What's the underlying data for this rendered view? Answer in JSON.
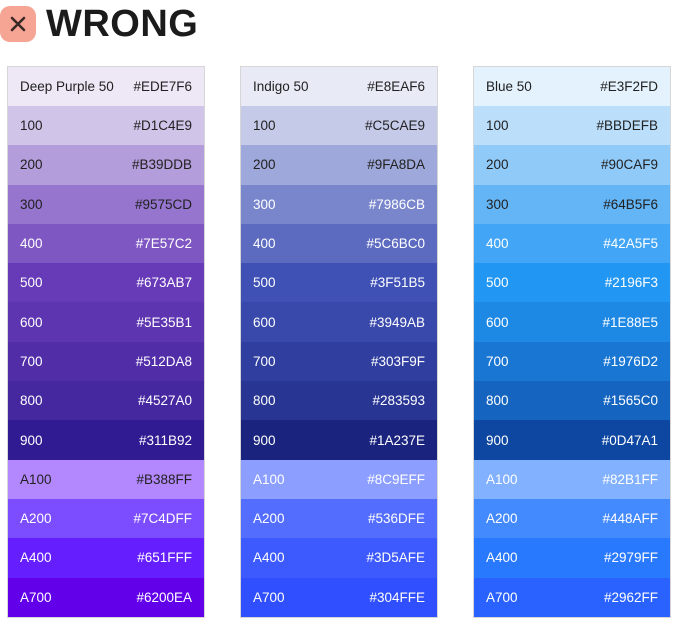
{
  "header": {
    "icon": "close-icon",
    "badge_color": "#F6A594",
    "title": "WRONG"
  },
  "palettes": [
    {
      "swatches": [
        {
          "name": "Deep Purple 50",
          "hex": "#EDE7F6",
          "text": "#212121"
        },
        {
          "name": "100",
          "hex": "#D1C4E9",
          "text": "#212121"
        },
        {
          "name": "200",
          "hex": "#B39DDB",
          "text": "#212121"
        },
        {
          "name": "300",
          "hex": "#9575CD",
          "text": "#212121"
        },
        {
          "name": "400",
          "hex": "#7E57C2",
          "text": "#ffffff"
        },
        {
          "name": "500",
          "hex": "#673AB7",
          "text": "#ffffff"
        },
        {
          "name": "600",
          "hex": "#5E35B1",
          "text": "#ffffff"
        },
        {
          "name": "700",
          "hex": "#512DA8",
          "text": "#ffffff"
        },
        {
          "name": "800",
          "hex": "#4527A0",
          "text": "#ffffff"
        },
        {
          "name": "900",
          "hex": "#311B92",
          "text": "#ffffff"
        },
        {
          "name": "A100",
          "hex": "#B388FF",
          "text": "#212121"
        },
        {
          "name": "A200",
          "hex": "#7C4DFF",
          "text": "#ffffff"
        },
        {
          "name": "A400",
          "hex": "#651FFF",
          "text": "#ffffff"
        },
        {
          "name": "A700",
          "hex": "#6200EA",
          "text": "#ffffff"
        }
      ]
    },
    {
      "swatches": [
        {
          "name": "Indigo 50",
          "hex": "#E8EAF6",
          "text": "#212121"
        },
        {
          "name": "100",
          "hex": "#C5CAE9",
          "text": "#212121"
        },
        {
          "name": "200",
          "hex": "#9FA8DA",
          "text": "#212121"
        },
        {
          "name": "300",
          "hex": "#7986CB",
          "text": "#ffffff"
        },
        {
          "name": "400",
          "hex": "#5C6BC0",
          "text": "#ffffff"
        },
        {
          "name": "500",
          "hex": "#3F51B5",
          "text": "#ffffff"
        },
        {
          "name": "600",
          "hex": "#3949AB",
          "text": "#ffffff"
        },
        {
          "name": "700",
          "hex": "#303F9F",
          "text": "#ffffff"
        },
        {
          "name": "800",
          "hex": "#283593",
          "text": "#ffffff"
        },
        {
          "name": "900",
          "hex": "#1A237E",
          "text": "#ffffff"
        },
        {
          "name": "A100",
          "hex": "#8C9EFF",
          "text": "#ffffff"
        },
        {
          "name": "A200",
          "hex": "#536DFE",
          "text": "#ffffff"
        },
        {
          "name": "A400",
          "hex": "#3D5AFE",
          "text": "#ffffff"
        },
        {
          "name": "A700",
          "hex": "#304FFE",
          "text": "#ffffff"
        }
      ]
    },
    {
      "swatches": [
        {
          "name": "Blue 50",
          "hex": "#E3F2FD",
          "text": "#212121"
        },
        {
          "name": "100",
          "hex": "#BBDEFB",
          "text": "#212121"
        },
        {
          "name": "200",
          "hex": "#90CAF9",
          "text": "#212121"
        },
        {
          "name": "300",
          "hex": "#64B5F6",
          "text": "#212121"
        },
        {
          "name": "400",
          "hex": "#42A5F5",
          "text": "#ffffff"
        },
        {
          "name": "500",
          "hex": "#2196F3",
          "text": "#ffffff"
        },
        {
          "name": "600",
          "hex": "#1E88E5",
          "text": "#ffffff"
        },
        {
          "name": "700",
          "hex": "#1976D2",
          "text": "#ffffff"
        },
        {
          "name": "800",
          "hex": "#1565C0",
          "text": "#ffffff"
        },
        {
          "name": "900",
          "hex": "#0D47A1",
          "text": "#ffffff"
        },
        {
          "name": "A100",
          "hex": "#82B1FF",
          "text": "#ffffff"
        },
        {
          "name": "A200",
          "hex": "#448AFF",
          "text": "#ffffff"
        },
        {
          "name": "A400",
          "hex": "#2979FF",
          "text": "#ffffff"
        },
        {
          "name": "A700",
          "hex": "#2962FF",
          "text": "#ffffff"
        }
      ]
    }
  ]
}
